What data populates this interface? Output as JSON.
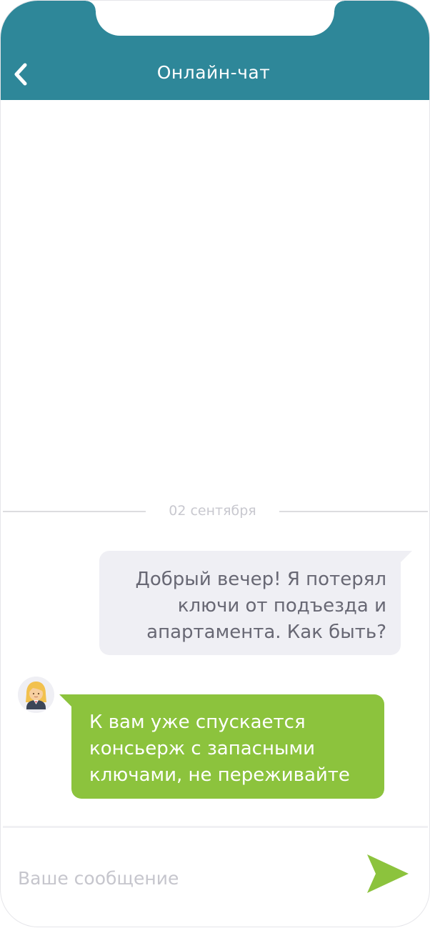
{
  "header": {
    "title": "Онлайн-чат",
    "back_icon": "chevron-left-icon",
    "background": "#2e8799"
  },
  "chat": {
    "date_separator": "02 сентября",
    "messages": [
      {
        "direction": "outgoing",
        "lines": [
          "Добрый вечер! Я потерял",
          "ключи от  подъезда и",
          "апартамента. Как быть?"
        ],
        "bubble_color": "#efeff4"
      },
      {
        "direction": "incoming",
        "avatar_icon": "woman-concierge-avatar-icon",
        "lines": [
          "К вам уже спускается",
          "консьерж с запасными",
          "ключами, не переживайте"
        ],
        "bubble_color": "#8cc33d"
      }
    ]
  },
  "composer": {
    "placeholder": "Ваше сообщение",
    "value": "",
    "send_icon": "send-arrow-icon",
    "accent": "#8cc33d"
  }
}
